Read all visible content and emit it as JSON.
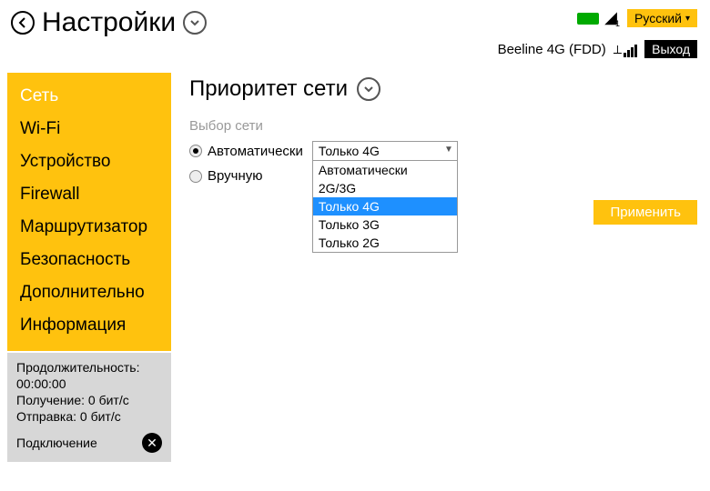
{
  "header": {
    "page_title": "Настройки",
    "language": "Русский",
    "status_text": "Beeline 4G (FDD)",
    "logout_label": "Выход"
  },
  "sidebar": {
    "items": [
      {
        "label": "Сеть",
        "active": true
      },
      {
        "label": "Wi-Fi",
        "active": false
      },
      {
        "label": "Устройство",
        "active": false
      },
      {
        "label": "Firewall",
        "active": false
      },
      {
        "label": "Маршрутизатор",
        "active": false
      },
      {
        "label": "Безопасность",
        "active": false
      },
      {
        "label": "Дополнительно",
        "active": false
      },
      {
        "label": "Информация",
        "active": false
      }
    ]
  },
  "stats": {
    "duration_label": "Продолжительность:",
    "duration_value": "00:00:00",
    "rx_label": "Получение: 0 бит/с",
    "tx_label": "Отправка: 0 бит/с",
    "connection_label": "Подключение"
  },
  "main": {
    "title": "Приоритет сети",
    "section_label": "Выбор сети",
    "mode_auto_label": "Автоматически",
    "mode_manual_label": "Вручную",
    "mode_selected": "auto",
    "select_value": "Только 4G",
    "select_options": [
      {
        "label": "Автоматически",
        "highlight": false
      },
      {
        "label": "2G/3G",
        "highlight": false
      },
      {
        "label": "Только 4G",
        "highlight": true
      },
      {
        "label": "Только 3G",
        "highlight": false
      },
      {
        "label": "Только 2G",
        "highlight": false
      }
    ],
    "apply_label": "Применить"
  }
}
